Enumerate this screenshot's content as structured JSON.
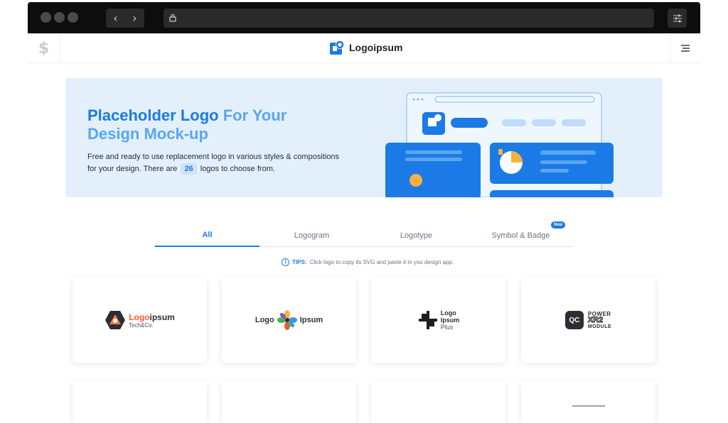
{
  "colors": {
    "accent": "#1b7ae6",
    "accent_light": "#5aa6f2",
    "hero_bg": "#e3f0fc",
    "chrome_bg": "#0d0d0d"
  },
  "browser": {
    "back_icon": "chevron-left-icon",
    "forward_icon": "chevron-right-icon",
    "lock_icon": "lock-icon",
    "settings_icon": "sliders-icon"
  },
  "header": {
    "currency_icon": "dollar-icon",
    "brand_name": "Logoipsum",
    "menu_icon": "hamburger-icon"
  },
  "hero": {
    "title_strong": "Placeholder Logo",
    "title_light_1": " For Your",
    "title_light_2": "Design Mock-up",
    "desc_1": "Free and ready to use replacement logo in various styles & compositions for your design. There are",
    "count": "26",
    "desc_2": "logos to choose from."
  },
  "tabs": [
    {
      "label": "All",
      "active": true
    },
    {
      "label": "Logogram"
    },
    {
      "label": "Logotype"
    },
    {
      "label": "Symbol & Badge"
    }
  ],
  "tab_badge": "New",
  "tips": {
    "label": "TIPS:",
    "text": "Click logo to copy its SVG and paste it in you design app."
  },
  "logos": [
    {
      "part1": "Logo",
      "part2": "ipsum",
      "sub": "Tech&Co."
    },
    {
      "left": "Logo",
      "right": "Ipsum"
    },
    {
      "line1": "Logo",
      "line2": "Ipsum",
      "line3": "Plus"
    },
    {
      "mark": "QC",
      "line1": "POWER",
      "line2": "XR2",
      "line3": "MODULE"
    }
  ]
}
